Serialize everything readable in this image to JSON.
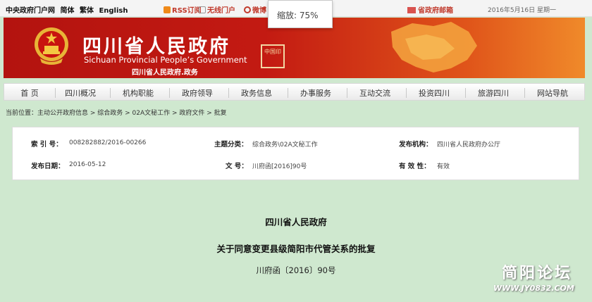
{
  "topbar": {
    "links": [
      "中央政府门户网",
      "简体",
      "繁体",
      "English"
    ],
    "rss": "RSS订阅",
    "wireless": "无线门户",
    "weibo": "微博",
    "mailbox": "省政府邮箱",
    "date": "2016年5月16日  星期一"
  },
  "zoom": {
    "label": "缩放: 75%"
  },
  "banner": {
    "title_cn": "四川省人民政府",
    "title_en": "Sichuan Provincial People’s Government",
    "subtitle": "四川省人民政府.政务",
    "seal_text": "中国印"
  },
  "nav": {
    "items": [
      "首 页",
      "四川概况",
      "机构职能",
      "政府领导",
      "政务信息",
      "办事服务",
      "互动交流",
      "投资四川",
      "旅游四川",
      "网站导航"
    ]
  },
  "breadcrumb": {
    "text": "当前位置：主动公开政府信息 > 综合政务 > 02A文秘工作 > 政府文件 > 批复"
  },
  "info": {
    "index_label": "索 引 号：",
    "index_value": "008282882/2016-00266",
    "topic_label": "主题分类：",
    "topic_value": "综合政务\\02A文秘工作",
    "org_label": "发布机构：",
    "org_value": "四川省人民政府办公厅",
    "date_label": "发布日期：",
    "date_value": "2016-05-12",
    "docno_label": "文  号：",
    "docno_value": "川府函[2016]90号",
    "validity_label": "有 效 性：",
    "validity_value": "有效"
  },
  "document": {
    "issuer": "四川省人民政府",
    "title": "关于同意变更县级简阳市代管关系的批复",
    "number": "川府函〔2016〕90号"
  },
  "watermark": {
    "name": "简阳论坛",
    "url": "WWW.JY0832.COM"
  },
  "colors": {
    "banner": "#c31a12",
    "page_bg": "#cfe8cf",
    "accent": "#c0392b"
  }
}
